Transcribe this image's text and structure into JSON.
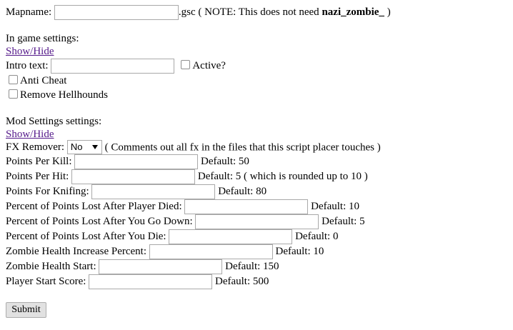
{
  "mapname": {
    "label": "Mapname:",
    "value": "",
    "suffix": ".gsc ( NOTE: This does not need ",
    "bold": "nazi_zombie_",
    "close": " )"
  },
  "ingame": {
    "heading": "In game settings:",
    "toggle": "Show/Hide",
    "intro_label": "Intro text:",
    "intro_value": "",
    "active_label": "Active?",
    "anticheat_label": "Anti Cheat",
    "hellhounds_label": "Remove Hellhounds"
  },
  "mod": {
    "heading": "Mod Settings settings:",
    "toggle": "Show/Hide",
    "fx_label": "FX Remover:",
    "fx_selected": "No",
    "fx_note": "( Comments out all fx in the files that this script placer touches )",
    "fields": [
      {
        "label": "Points Per Kill:",
        "default": "Default: 50"
      },
      {
        "label": "Points Per Hit:",
        "default": "Default: 5 ( which is rounded up to 10 )"
      },
      {
        "label": "Points For Knifing:",
        "default": "Default: 80"
      },
      {
        "label": "Percent of Points Lost After Player Died:",
        "default": "Default: 10"
      },
      {
        "label": "Percent of Points Lost After You Go Down:",
        "default": "Default: 5"
      },
      {
        "label": "Percent of Points Lost After You Die:",
        "default": "Default: 0"
      },
      {
        "label": "Zombie Health Increase Percent:",
        "default": "Default: 10"
      },
      {
        "label": "Zombie Health Start:",
        "default": "Default: 150"
      },
      {
        "label": "Player Start Score:",
        "default": "Default: 500"
      }
    ]
  },
  "submit_label": "Submit"
}
